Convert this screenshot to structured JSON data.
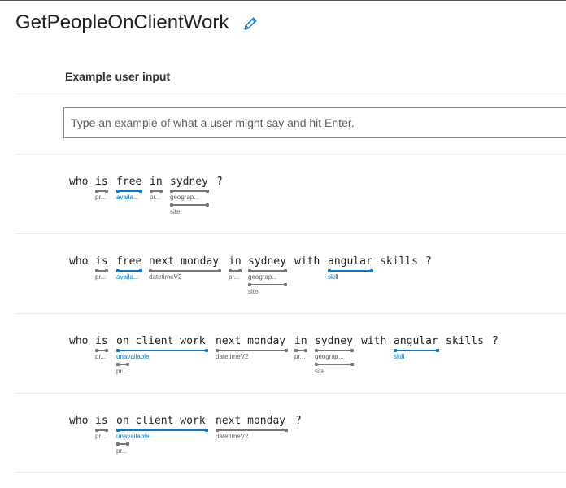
{
  "intent": {
    "title": "GetPeopleOnClientWork"
  },
  "example_section": {
    "label": "Example user input",
    "input_placeholder": "Type an example of what a user might say and hit Enter."
  },
  "utterances": [
    {
      "tokens": [
        "who",
        "is",
        "free",
        "in",
        "sydney",
        "?"
      ],
      "labels": {
        "a": "pr...",
        "b": "availa...",
        "c": "pr...",
        "d": "geograp...",
        "e": "site"
      }
    },
    {
      "tokens": [
        "who",
        "is",
        "free",
        "next monday",
        "in",
        "sydney",
        "with",
        "angular",
        "skills",
        "?"
      ],
      "labels": {
        "a": "pr...",
        "b": "availa...",
        "c": "datetimeV2",
        "d": "pr...",
        "e": "geograp...",
        "f": "site",
        "g": "skill"
      }
    },
    {
      "tokens": [
        "who",
        "is",
        "on client work",
        "next monday",
        "in",
        "sydney",
        "with",
        "angular",
        "skills",
        "?"
      ],
      "labels": {
        "a": "pr...",
        "b": "unavailable",
        "c": "pr...",
        "d": "datetimeV2",
        "e": "pr...",
        "f": "geograp...",
        "g": "site",
        "h": "skill"
      }
    },
    {
      "tokens": [
        "who",
        "is",
        "on client work",
        "next monday",
        "?"
      ],
      "labels": {
        "a": "pr...",
        "b": "unavailable",
        "c": "pr...",
        "d": "datetimeV2"
      }
    }
  ],
  "colors": {
    "entity_blue": "#0078d4",
    "entity_gray": "#777777"
  },
  "icons": {
    "edit": "pencil-icon"
  }
}
